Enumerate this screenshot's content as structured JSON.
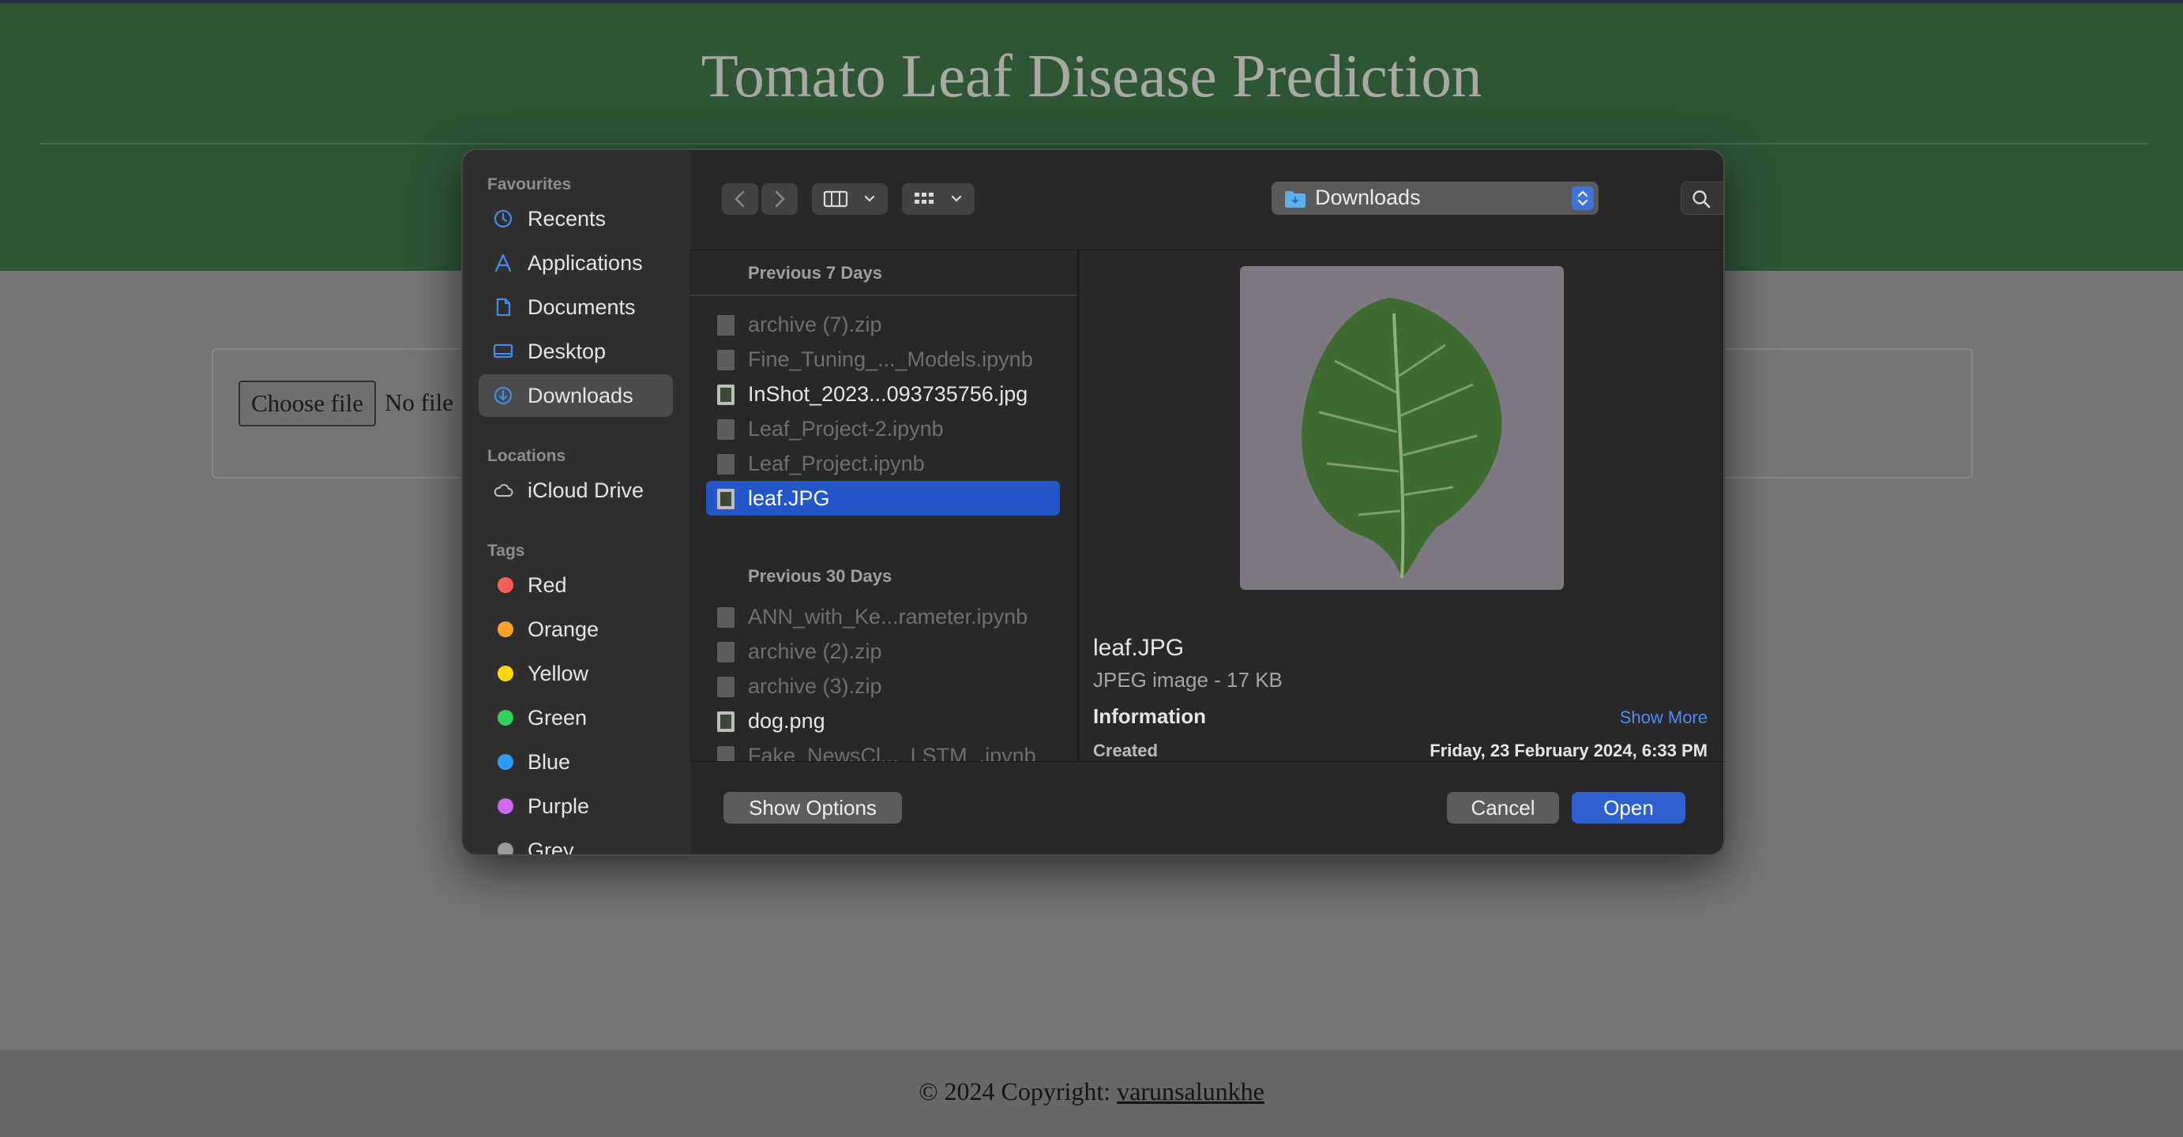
{
  "page": {
    "title": "Tomato Leaf Disease Prediction",
    "upload": {
      "button_label": "Choose file",
      "status_text": "No file"
    },
    "footer": {
      "text": "© 2024 Copyright: ",
      "link": "varunsalunkhe"
    }
  },
  "dialog": {
    "sidebar": {
      "favourites_heading": "Favourites",
      "favourites": [
        {
          "label": "Recents",
          "icon": "clock-icon"
        },
        {
          "label": "Applications",
          "icon": "applications-icon"
        },
        {
          "label": "Documents",
          "icon": "document-icon"
        },
        {
          "label": "Desktop",
          "icon": "desktop-icon"
        },
        {
          "label": "Downloads",
          "icon": "download-icon",
          "selected": true
        }
      ],
      "locations_heading": "Locations",
      "locations": [
        {
          "label": "iCloud Drive",
          "icon": "cloud-icon"
        }
      ],
      "tags_heading": "Tags",
      "tags": [
        {
          "label": "Red",
          "color": "#ff5f57"
        },
        {
          "label": "Orange",
          "color": "#ffa12b"
        },
        {
          "label": "Yellow",
          "color": "#ffd60a"
        },
        {
          "label": "Green",
          "color": "#30d158"
        },
        {
          "label": "Blue",
          "color": "#2f9bff"
        },
        {
          "label": "Purple",
          "color": "#d267ee"
        },
        {
          "label": "Grey",
          "color": "#98989d"
        }
      ]
    },
    "toolbar": {
      "location": "Downloads",
      "search_placeholder": "Search"
    },
    "file_list": {
      "section1": {
        "title": "Previous 7 Days",
        "files": [
          {
            "name": "archive (7).zip",
            "enabled": false,
            "icon": "document-icon"
          },
          {
            "name": "Fine_Tuning_..._Models.ipynb",
            "enabled": false,
            "icon": "document-icon"
          },
          {
            "name": "InShot_2023...093735756.jpg",
            "enabled": true,
            "icon": "image-icon"
          },
          {
            "name": "Leaf_Project-2.ipynb",
            "enabled": false,
            "icon": "document-icon"
          },
          {
            "name": "Leaf_Project.ipynb",
            "enabled": false,
            "icon": "document-icon"
          },
          {
            "name": "leaf.JPG",
            "enabled": true,
            "selected": true,
            "icon": "image-icon"
          }
        ]
      },
      "section2": {
        "title": "Previous 30 Days",
        "files": [
          {
            "name": "ANN_with_Ke...rameter.ipynb",
            "enabled": false,
            "icon": "document-icon"
          },
          {
            "name": "archive (2).zip",
            "enabled": false,
            "icon": "document-icon"
          },
          {
            "name": "archive (3).zip",
            "enabled": false,
            "icon": "document-icon"
          },
          {
            "name": "dog.png",
            "enabled": true,
            "icon": "image-icon"
          },
          {
            "name": "Fake_NewsCl..._LSTM_.ipynb",
            "enabled": false,
            "icon": "document-icon"
          }
        ]
      }
    },
    "preview": {
      "name": "leaf.JPG",
      "kind": "JPEG image - 17 KB",
      "info_heading": "Information",
      "show_more": "Show More",
      "created_label": "Created",
      "created_value": "Friday, 23 February 2024, 6:33 PM"
    },
    "buttons": {
      "show_options": "Show Options",
      "cancel": "Cancel",
      "open": "Open"
    }
  }
}
